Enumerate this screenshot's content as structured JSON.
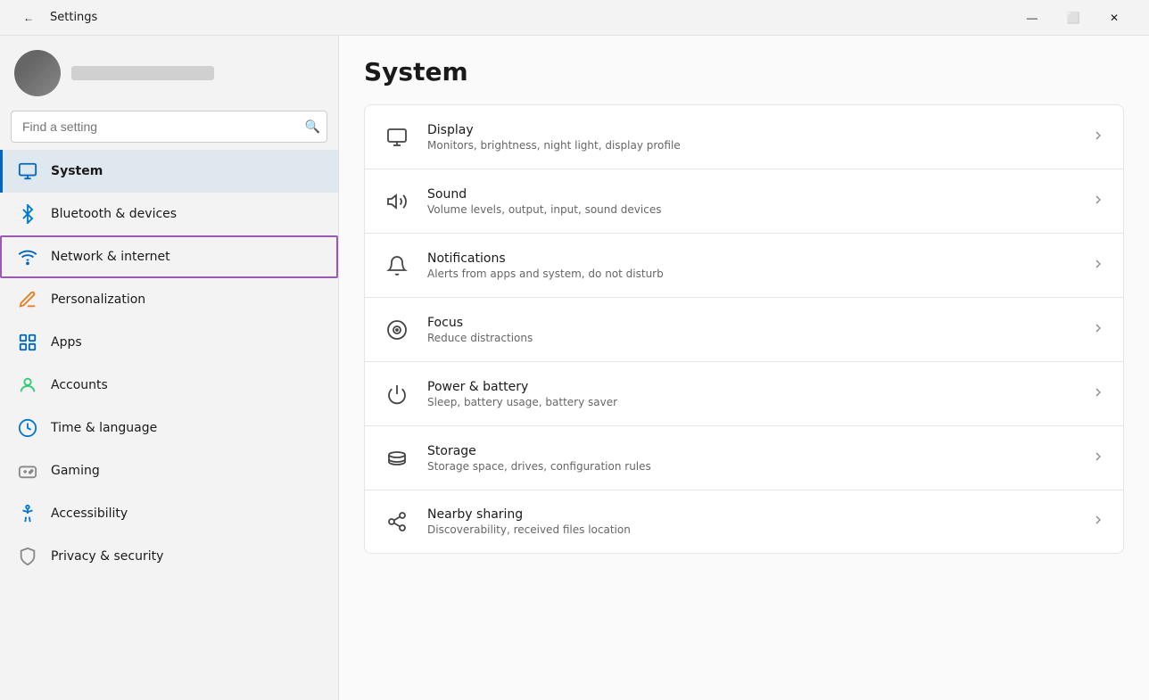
{
  "titleBar": {
    "title": "Settings",
    "backLabel": "←",
    "minimize": "—",
    "maximize": "⬜",
    "close": "✕"
  },
  "sidebar": {
    "searchPlaceholder": "Find a setting",
    "items": [
      {
        "id": "system",
        "label": "System",
        "icon": "🖥",
        "active": true,
        "selectedOutline": false
      },
      {
        "id": "bluetooth",
        "label": "Bluetooth & devices",
        "icon": "🔵",
        "active": false,
        "selectedOutline": false
      },
      {
        "id": "network",
        "label": "Network & internet",
        "icon": "📶",
        "active": false,
        "selectedOutline": true
      },
      {
        "id": "personalization",
        "label": "Personalization",
        "icon": "✏️",
        "active": false,
        "selectedOutline": false
      },
      {
        "id": "apps",
        "label": "Apps",
        "icon": "🟦",
        "active": false,
        "selectedOutline": false
      },
      {
        "id": "accounts",
        "label": "Accounts",
        "icon": "👤",
        "active": false,
        "selectedOutline": false
      },
      {
        "id": "time",
        "label": "Time & language",
        "icon": "🌐",
        "active": false,
        "selectedOutline": false
      },
      {
        "id": "gaming",
        "label": "Gaming",
        "icon": "🎮",
        "active": false,
        "selectedOutline": false
      },
      {
        "id": "accessibility",
        "label": "Accessibility",
        "icon": "♿",
        "active": false,
        "selectedOutline": false
      },
      {
        "id": "privacy",
        "label": "Privacy & security",
        "icon": "🛡",
        "active": false,
        "selectedOutline": false
      }
    ]
  },
  "main": {
    "pageTitle": "System",
    "settings": [
      {
        "id": "display",
        "title": "Display",
        "description": "Monitors, brightness, night light, display profile",
        "icon": "🖥"
      },
      {
        "id": "sound",
        "title": "Sound",
        "description": "Volume levels, output, input, sound devices",
        "icon": "🔊"
      },
      {
        "id": "notifications",
        "title": "Notifications",
        "description": "Alerts from apps and system, do not disturb",
        "icon": "🔔"
      },
      {
        "id": "focus",
        "title": "Focus",
        "description": "Reduce distractions",
        "icon": "🎯"
      },
      {
        "id": "power",
        "title": "Power & battery",
        "description": "Sleep, battery usage, battery saver",
        "icon": "⏻"
      },
      {
        "id": "storage",
        "title": "Storage",
        "description": "Storage space, drives, configuration rules",
        "icon": "💾"
      },
      {
        "id": "nearby",
        "title": "Nearby sharing",
        "description": "Discoverability, received files location",
        "icon": "↗"
      }
    ]
  }
}
